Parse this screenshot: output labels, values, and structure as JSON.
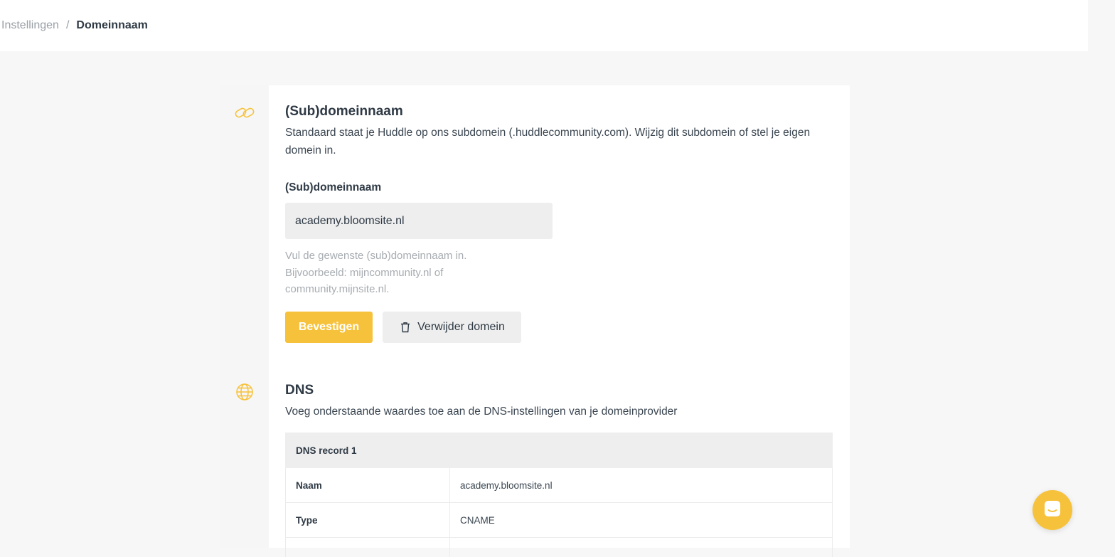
{
  "breadcrumb": {
    "parent": "Instellingen",
    "separator": "/",
    "current": "Domeinnaam"
  },
  "subdomain_section": {
    "icon": "link-icon",
    "title": "(Sub)domeinnaam",
    "description": "Standaard staat je Huddle op ons subdomein (.huddlecommunity.com). Wijzig dit subdomein of stel je eigen domein in.",
    "field_label": "(Sub)domeinnaam",
    "field_value": "academy.bloomsite.nl",
    "field_hint": "Vul de gewenste (sub)domeinnaam in. Bijvoorbeeld: mijncommunity.nl of community.mijnsite.nl.",
    "confirm_label": "Bevestigen",
    "delete_label": "Verwijder domein"
  },
  "dns_section": {
    "icon": "globe-icon",
    "title": "DNS",
    "description": "Voeg onderstaande waardes toe aan de DNS-instellingen van je domeinprovider",
    "record_title": "DNS record 1",
    "rows": [
      {
        "key": "Naam",
        "value": "academy.bloomsite.nl"
      },
      {
        "key": "Type",
        "value": "CNAME"
      }
    ]
  },
  "colors": {
    "accent": "#f7c23b",
    "background": "#f7f7f7",
    "text": "#2f3a45"
  },
  "chat": {
    "icon": "chat-icon"
  }
}
